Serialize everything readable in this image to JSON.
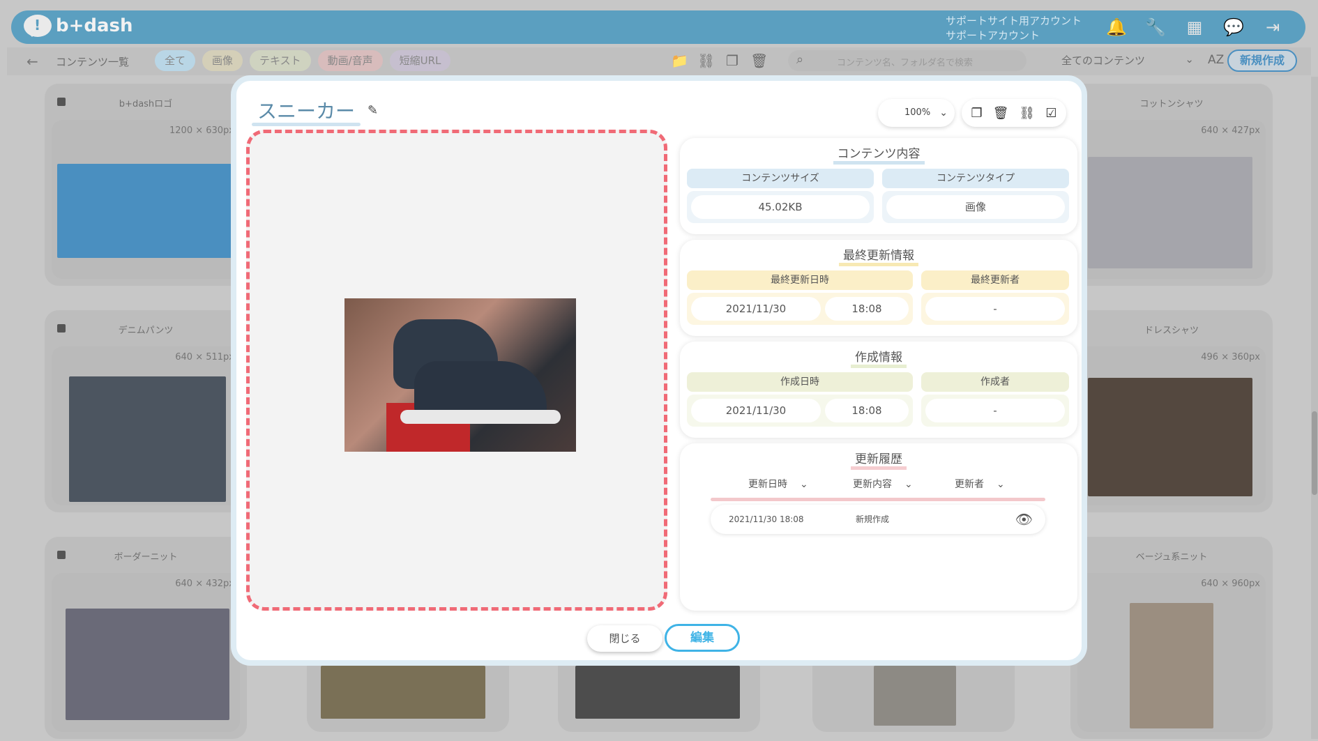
{
  "header": {
    "logo_text": "b+dash",
    "account_line1": "サポートサイト用アカウント",
    "account_line2": "サポートアカウント"
  },
  "subnav": {
    "back_icon": "arrow-left-icon",
    "title": "コンテンツ一覧",
    "filters": [
      {
        "label": "全て",
        "color": "#b9d6e6"
      },
      {
        "label": "画像",
        "color": "#d4cfb8"
      },
      {
        "label": "テキスト",
        "color": "#cfd3c0"
      },
      {
        "label": "動画/音声",
        "color": "#d8bcbc"
      },
      {
        "label": "短縮URL",
        "color": "#c6bfcf"
      }
    ],
    "search_placeholder": "コンテンツ名、フォルダ名で検索",
    "filter_select": "全てのコンテンツ",
    "sort_label": "AZ",
    "new_button": "新規作成"
  },
  "grid": [
    {
      "title": "b+dashロゴ",
      "size": "1200 × 630px"
    },
    {
      "title": "デニムパンツ",
      "size": "640 × 511px"
    },
    {
      "title": "ボーダーニット",
      "size": "640 × 432px"
    },
    {
      "title": "コットンシャツ",
      "size": "640 × 427px"
    },
    {
      "title": "ドレスシャツ",
      "size": "496 × 360px"
    },
    {
      "title": "ベージュ系ニット",
      "size": "640 × 960px"
    }
  ],
  "modal": {
    "title": "スニーカー",
    "zoom": "100%",
    "content_panel": {
      "title": "コンテンツ内容",
      "size_label": "コンテンツサイズ",
      "size_value": "45.02KB",
      "type_label": "コンテンツタイプ",
      "type_value": "画像"
    },
    "updated_panel": {
      "title": "最終更新情報",
      "date_label": "最終更新日時",
      "date": "2021/11/30",
      "time": "18:08",
      "user_label": "最終更新者",
      "user": "-"
    },
    "created_panel": {
      "title": "作成情報",
      "date_label": "作成日時",
      "date": "2021/11/30",
      "time": "18:08",
      "user_label": "作成者",
      "user": "-"
    },
    "history_panel": {
      "title": "更新履歴",
      "col_date": "更新日時",
      "col_content": "更新内容",
      "col_user": "更新者",
      "rows": [
        {
          "datetime": "2021/11/30 18:08",
          "content": "新規作成"
        }
      ]
    },
    "close_button": "閉じる",
    "edit_button": "編集"
  }
}
